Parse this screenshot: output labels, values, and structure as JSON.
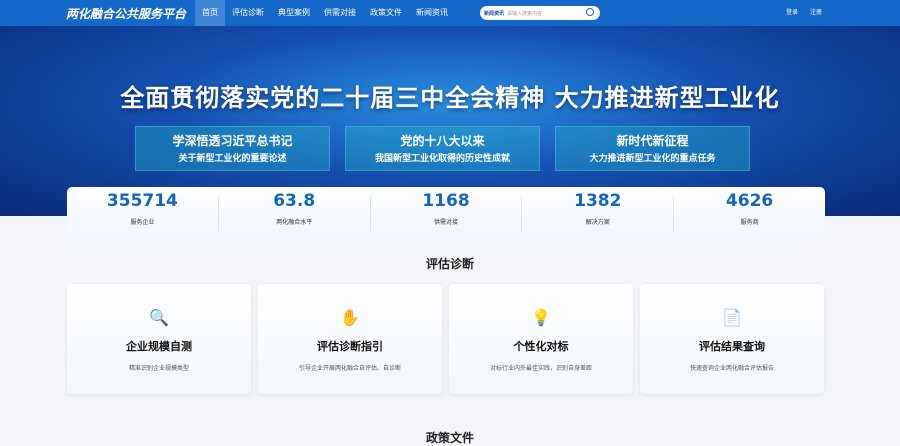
{
  "nav": {
    "logo": "两化融合公共服务平台",
    "menu": [
      "首页",
      "评估诊断",
      "典型案例",
      "供需对接",
      "政策文件",
      "新闻资讯"
    ],
    "search_select": "新闻资讯",
    "search_placeholder": "请输入搜索内容",
    "login": "登录",
    "register": "注册"
  },
  "banner": {
    "title": "全面贯彻落实党的二十届三中全会精神  大力推进新型工业化",
    "boxes": [
      {
        "a": "学深悟透习近平总书记",
        "b": "关于新型工业化的重要论述"
      },
      {
        "a": "党的十八大以来",
        "b": "我国新型工业化取得的历史性成就"
      },
      {
        "a": "新时代新征程",
        "b": "大力推进新型工业化的重点任务"
      }
    ]
  },
  "stats": [
    {
      "v": "355714",
      "l": "服务企业"
    },
    {
      "v": "63.8",
      "l": "两化融合水平"
    },
    {
      "v": "1168",
      "l": "供需对接"
    },
    {
      "v": "1382",
      "l": "解决方案"
    },
    {
      "v": "4626",
      "l": "服务商"
    }
  ],
  "section1": "评估诊断",
  "cards": [
    {
      "icon": "🔍",
      "t": "企业规模自测",
      "d": "精准识别企业规模类型"
    },
    {
      "icon": "✋",
      "t": "评估诊断指引",
      "d": "引导企业开展两化融合自评估、自诊断"
    },
    {
      "icon": "💡",
      "t": "个性化对标",
      "d": "对标行业内外最佳实践，识别自身差距"
    },
    {
      "icon": "📄",
      "t": "评估结果查询",
      "d": "快速查询企业两化融合评估报告"
    }
  ],
  "section2": "政策文件"
}
